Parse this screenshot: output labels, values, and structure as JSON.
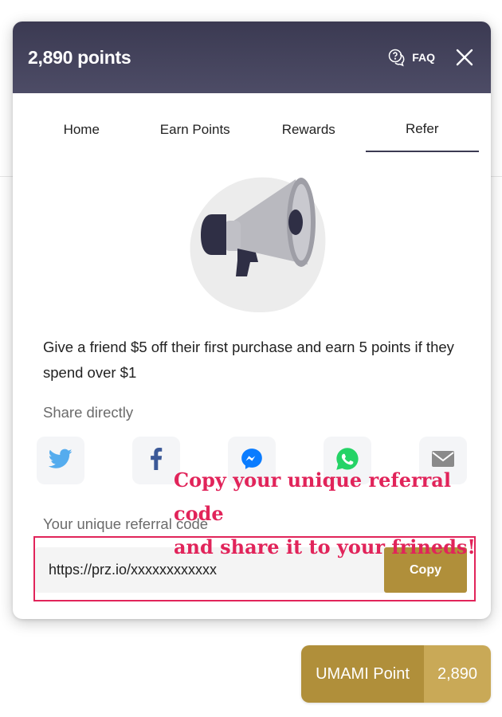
{
  "header": {
    "points_title": "2,890 points",
    "faq_label": "FAQ"
  },
  "tabs": [
    {
      "label": "Home"
    },
    {
      "label": "Earn Points"
    },
    {
      "label": "Rewards"
    },
    {
      "label": "Refer",
      "active": true
    }
  ],
  "refer": {
    "description": "Give a friend $5 off their first purchase and earn 5 points if they spend over $1",
    "share_label": "Share directly",
    "share_buttons": [
      "twitter-icon",
      "facebook-icon",
      "messenger-icon",
      "whatsapp-icon",
      "email-icon"
    ],
    "referral_label": "Your unique referral code",
    "referral_url": "https://prz.io/xxxxxxxxxxxx",
    "copy_label": "Copy"
  },
  "annotation": {
    "line1": "Copy your unique referral code",
    "line2": "and share it to your frineds!",
    "color": "#e1245a"
  },
  "launcher": {
    "label": "UMAMI Point",
    "count": "2,890"
  },
  "colors": {
    "header": "#3b3a52",
    "accent_gold": "#b08f3a",
    "accent_gold_light": "#c9a957"
  }
}
